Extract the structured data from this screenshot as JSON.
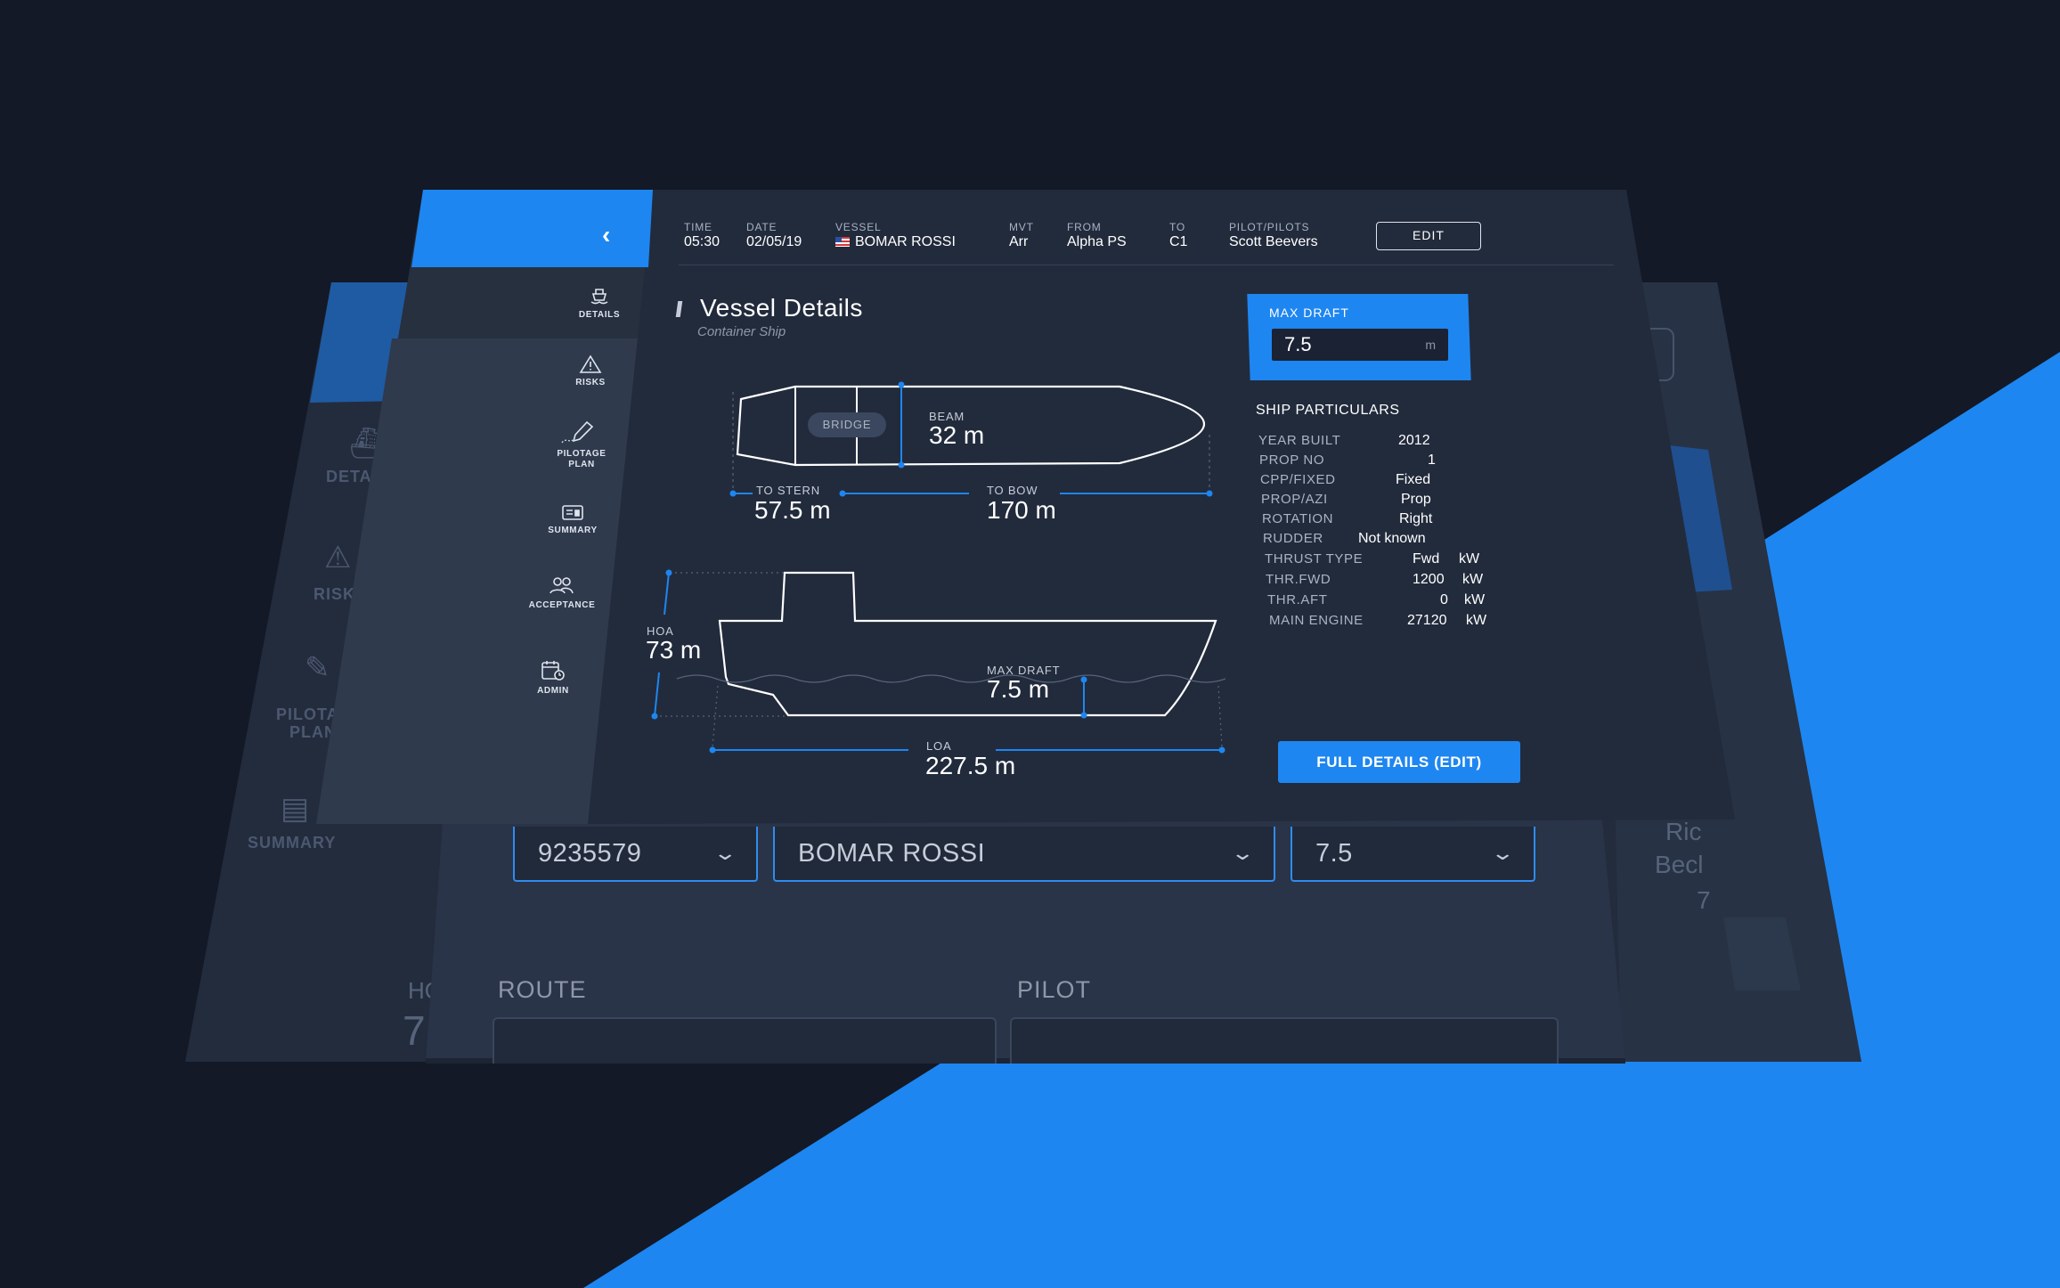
{
  "colors": {
    "accent": "#1e86f0",
    "background": "#131926",
    "panel": "#222b3c",
    "sidebar": "#27303f"
  },
  "back_layer": {
    "nav": [
      {
        "label": "DETAI",
        "icon": "ship-icon"
      },
      {
        "label": "RISK",
        "icon": "warning-icon"
      },
      {
        "label": "PILOTA",
        "label2": "PLAN",
        "icon": "pen-icon"
      },
      {
        "label": "SUMMARY",
        "icon": "summary-icon"
      }
    ],
    "faint_left": [
      "HO",
      "7"
    ],
    "faint_right": [
      "Ric",
      "Becl",
      "7"
    ]
  },
  "form": {
    "selects": [
      {
        "value": "9235579"
      },
      {
        "value": "BOMAR ROSSI"
      },
      {
        "value": "7.5"
      }
    ],
    "route_label": "ROUTE",
    "pilot_label": "PILOT"
  },
  "sidebar": {
    "back_icon": "chevron-left-icon",
    "items": [
      {
        "label": "DETAILS",
        "icon": "ship-icon"
      },
      {
        "label": "RISKS",
        "icon": "warning-icon"
      },
      {
        "label": "PILOTAGE",
        "label2": "PLAN",
        "icon": "pen-icon"
      },
      {
        "label": "SUMMARY",
        "icon": "summary-icon"
      },
      {
        "label": "ACCEPTANCE",
        "icon": "people-icon"
      },
      {
        "label": "ADMIN",
        "icon": "calendar-clock-icon"
      }
    ]
  },
  "header": {
    "time": {
      "label": "TIME",
      "value": "05:30"
    },
    "date": {
      "label": "DATE",
      "value": "02/05/19"
    },
    "vessel": {
      "label": "VESSEL",
      "value": "BOMAR ROSSI"
    },
    "mvt": {
      "label": "MVT",
      "value": "Arr"
    },
    "from": {
      "label": "FROM",
      "value": "Alpha PS"
    },
    "to": {
      "label": "TO",
      "value": "C1"
    },
    "pilot": {
      "label": "PILOT/PILOTS",
      "value": "Scott Beevers"
    },
    "edit_label": "EDIT"
  },
  "vessel": {
    "title": "Vessel Details",
    "subtitle": "Container Ship"
  },
  "diagram": {
    "bridge": "BRIDGE",
    "beam": {
      "label": "BEAM",
      "value": "32 m"
    },
    "to_stern": {
      "label": "TO STERN",
      "value": "57.5 m"
    },
    "to_bow": {
      "label": "TO BOW",
      "value": "170 m"
    },
    "hoa": {
      "label": "HOA",
      "value": "73 m"
    },
    "max_draft": {
      "label": "MAX DRAFT",
      "value": "7.5 m"
    },
    "loa": {
      "label": "LOA",
      "value": "227.5 m"
    }
  },
  "max_draft_card": {
    "label": "MAX DRAFT",
    "value": "7.5",
    "unit": "m"
  },
  "particulars": {
    "title": "SHIP PARTICULARS",
    "rows": [
      {
        "key": "YEAR BUILT",
        "value": "2012",
        "unit": ""
      },
      {
        "key": "PROP NO",
        "value": "1",
        "unit": ""
      },
      {
        "key": "CPP/FIXED",
        "value": "Fixed",
        "unit": ""
      },
      {
        "key": "PROP/AZI",
        "value": "Prop",
        "unit": ""
      },
      {
        "key": "ROTATION",
        "value": "Right",
        "unit": ""
      },
      {
        "key": "RUDDER",
        "value": "Not known",
        "unit": ""
      },
      {
        "key": "THRUST TYPE",
        "value": "Fwd",
        "unit": "kW"
      },
      {
        "key": "THR.FWD",
        "value": "1200",
        "unit": "kW"
      },
      {
        "key": "THR.AFT",
        "value": "0",
        "unit": "kW"
      },
      {
        "key": "MAIN ENGINE",
        "value": "27120",
        "unit": "kW"
      }
    ]
  },
  "full_details_label": "FULL DETAILS (EDIT)"
}
